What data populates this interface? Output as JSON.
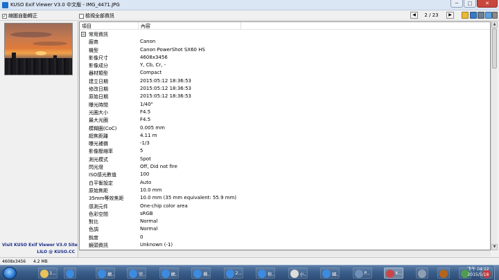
{
  "window": {
    "title": "KUSO Exif Viewer V3.0 中文版 - IMG_4471.JPG",
    "controls": {
      "minimize": "─",
      "maximize": "□",
      "close": "✕"
    }
  },
  "toolbar": {
    "auto_rotate_label": "縮圖自動轉正",
    "auto_rotate_checked": "✓",
    "show_all_label": "檢視全部資訊",
    "prev": "◀",
    "next": "▶",
    "page": "2 / 23",
    "icons": [
      "folder-icon",
      "save-icon",
      "disk-icon",
      "info-icon",
      "gear-icon",
      "help-icon"
    ]
  },
  "left_panel": {
    "promo_line1": "Visit KUSO Exif Viewer V3.0 Site",
    "promo_line2": "LILO @ KUSO.CC"
  },
  "table": {
    "columns": [
      "項目",
      "內容"
    ],
    "group": {
      "toggle": "−",
      "label": "常用資訊"
    },
    "rows": [
      {
        "key": "廠商",
        "value": "Canon"
      },
      {
        "key": "機型",
        "value": "Canon PowerShot SX60 HS"
      },
      {
        "key": "影像尺寸",
        "value": "4608x3456"
      },
      {
        "key": "影像成分",
        "value": "Y, Cb, Cr, -"
      },
      {
        "key": "器材類型",
        "value": "Compact"
      },
      {
        "key": "建立日期",
        "value": "2015:05:12 18:36:53"
      },
      {
        "key": "修改日期",
        "value": "2015:05:12 18:36:53"
      },
      {
        "key": "原始日期",
        "value": "2015:05:12 18:36:53"
      },
      {
        "key": "曝光時間",
        "value": "1/40\""
      },
      {
        "key": "光圈大小",
        "value": "F4.5"
      },
      {
        "key": "最大光圈",
        "value": "F4.5"
      },
      {
        "key": "模糊圈(CoC)",
        "value": "0.005 mm"
      },
      {
        "key": "超焦距離",
        "value": "4.11 m"
      },
      {
        "key": "曝光補償",
        "value": "-1/3"
      },
      {
        "key": "影像壓縮率",
        "value": "5"
      },
      {
        "key": "測光模式",
        "value": "Spot"
      },
      {
        "key": "閃光燈",
        "value": "Off, Did not fire"
      },
      {
        "key": "ISO感光數值",
        "value": "100"
      },
      {
        "key": "白平衡設定",
        "value": "Auto"
      },
      {
        "key": "原始焦距",
        "value": "10.0 mm"
      },
      {
        "key": "35mm等效焦距",
        "value": "10.0 mm (35 mm equivalent: 55.9 mm)"
      },
      {
        "key": "感測元件",
        "value": "One-chip color area"
      },
      {
        "key": "色彩空間",
        "value": "sRGB"
      },
      {
        "key": "對比",
        "value": "Normal"
      },
      {
        "key": "色調",
        "value": "Normal"
      },
      {
        "key": "銳度",
        "value": "0"
      },
      {
        "key": "鏡頭資訊",
        "value": "Unknown (-1)"
      }
    ]
  },
  "status": {
    "dimensions": "4608x3456",
    "filesize": "4.2 MB"
  },
  "taskbar": {
    "items": [
      {
        "name": "taskbar-folder",
        "label": "1...",
        "color": "#e8c25a"
      },
      {
        "name": "taskbar-ie-1",
        "label": "",
        "color": "#3d8be0"
      },
      {
        "name": "taskbar-ie-2",
        "label": "網...",
        "color": "#3d8be0"
      },
      {
        "name": "taskbar-ie-3",
        "label": "完...",
        "color": "#3d8be0"
      },
      {
        "name": "taskbar-ie-4",
        "label": "網...",
        "color": "#3d8be0"
      },
      {
        "name": "taskbar-ie-5",
        "label": "擷...",
        "color": "#3d8be0"
      },
      {
        "name": "taskbar-ie-6",
        "label": "2...",
        "color": "#3d8be0"
      },
      {
        "name": "taskbar-ie-7",
        "label": "你...",
        "color": "#3d8be0"
      },
      {
        "name": "taskbar-doc",
        "label": "小...",
        "color": "#dcdcdc"
      },
      {
        "name": "taskbar-ie-8",
        "label": "國...",
        "color": "#3d8be0"
      },
      {
        "name": "taskbar-app-1",
        "label": "P...",
        "color": "#6e8fb8"
      },
      {
        "name": "taskbar-kuso",
        "label": "K...",
        "color": "#c8464a"
      },
      {
        "name": "taskbar-app-2",
        "label": "",
        "color": "#8e9fb3"
      },
      {
        "name": "taskbar-app-3",
        "label": "",
        "color": "#b5651d"
      },
      {
        "name": "taskbar-app-4",
        "label": "",
        "color": "#4f9d4f"
      },
      {
        "name": "taskbar-app-5",
        "label": "",
        "color": "#c23b3b"
      }
    ],
    "clock_time": "下午 04:12",
    "clock_date": "2015/5/18"
  }
}
